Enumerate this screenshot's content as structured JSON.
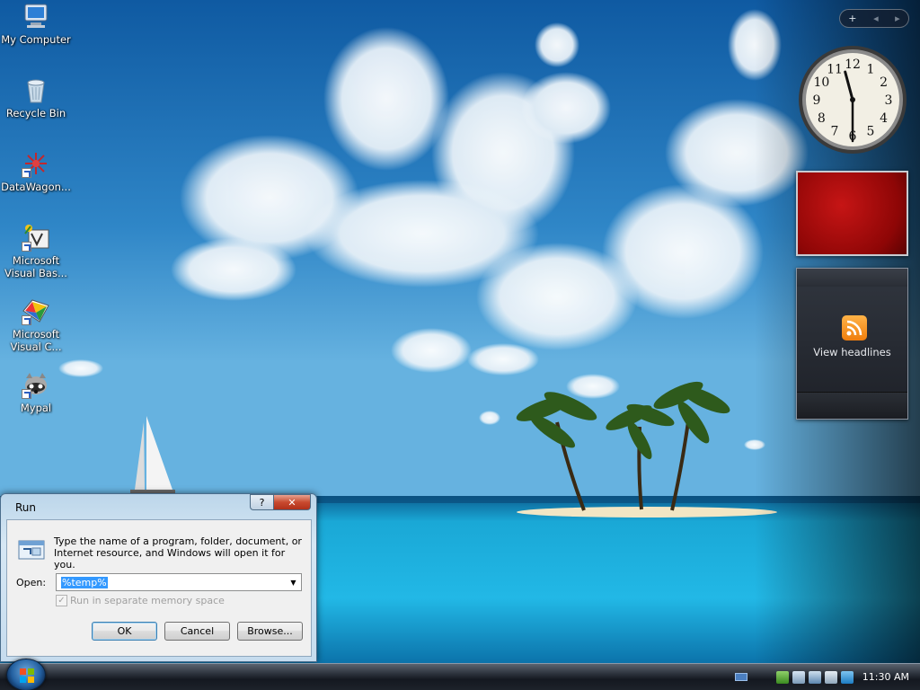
{
  "desktop": {
    "icons": [
      {
        "label": "My Computer",
        "icon": "my-computer-icon"
      },
      {
        "label": "Recycle Bin",
        "icon": "recycle-bin-icon"
      },
      {
        "label": "DataWagon...",
        "icon": "datawagon-icon"
      },
      {
        "label_line1": "Microsoft",
        "label_line2": "Visual Bas...",
        "icon": "visual-basic-icon"
      },
      {
        "label_line1": "Microsoft",
        "label_line2": "Visual C...",
        "icon": "visual-c-icon"
      },
      {
        "label": "Mypal",
        "icon": "mypal-icon"
      }
    ]
  },
  "sidebar": {
    "controls": {
      "add": "+",
      "prev": "◂",
      "next": "▸"
    },
    "clock": {
      "hours": 11,
      "minutes": 30,
      "numerals": [
        "12",
        "1",
        "2",
        "3",
        "4",
        "5",
        "6",
        "7",
        "8",
        "9",
        "10",
        "11"
      ]
    },
    "feeds": {
      "text": "View headlines",
      "icon": "rss-feed-icon"
    },
    "slideshow_color": "#b30e0e"
  },
  "run_dialog": {
    "title": "Run",
    "help_label": "?",
    "close_label": "✕",
    "message": "Type the name of a program, folder, document, or Internet resource, and Windows will open it for you.",
    "open_label": "Open:",
    "open_value": "%temp%",
    "checkbox_label": "Run in separate memory space",
    "checkbox_checked": true,
    "checkbox_enabled": false,
    "buttons": {
      "ok": "OK",
      "cancel": "Cancel",
      "browse": "Browse..."
    }
  },
  "taskbar": {
    "time": "11:30 AM",
    "tray_icons": [
      "keyboard-icon",
      "network-check-icon",
      "network-icon",
      "monitor-icon",
      "volume-icon",
      "tm-icon"
    ]
  }
}
